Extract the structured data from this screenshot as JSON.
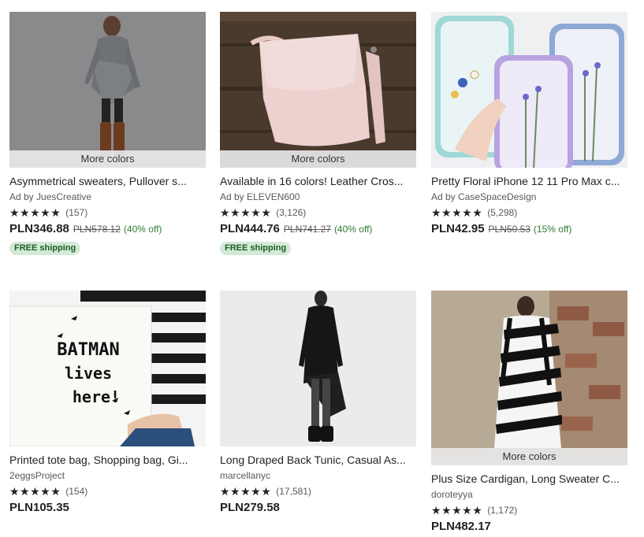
{
  "listings": [
    {
      "more_colors": "More colors",
      "title": "Asymmetrical sweaters, Pullover s...",
      "seller": "Ad by JuesCreative",
      "stars": "★★★★★",
      "reviews": "(157)",
      "price": "PLN346.88",
      "original_price": "PLN578.12",
      "discount": "(40% off)",
      "shipping": "FREE shipping"
    },
    {
      "more_colors": "More colors",
      "title": "Available in 16 colors! Leather Cros...",
      "seller": "Ad by ELEVEN600",
      "stars": "★★★★★",
      "reviews": "(3,126)",
      "price": "PLN444.76",
      "original_price": "PLN741.27",
      "discount": "(40% off)",
      "shipping": "FREE shipping"
    },
    {
      "title": "Pretty Floral iPhone 12 11 Pro Max c...",
      "seller": "Ad by CaseSpaceDesign",
      "stars": "★★★★★",
      "reviews": "(5,298)",
      "price": "PLN42.95",
      "original_price": "PLN50.53",
      "discount": "(15% off)"
    },
    {
      "title": "Printed tote bag, Shopping bag, Gi...",
      "seller": "2eggsProject",
      "stars": "★★★★★",
      "reviews": "(154)",
      "price": "PLN105.35",
      "image_text": [
        "BATMAN",
        "lives",
        "here!"
      ]
    },
    {
      "title": "Long Draped Back Tunic, Casual As...",
      "seller": "marcellanyc",
      "stars": "★★★★★",
      "reviews": "(17,581)",
      "price": "PLN279.58"
    },
    {
      "more_colors": "More colors",
      "title": "Plus Size Cardigan, Long Sweater C...",
      "seller": "doroteyya",
      "stars": "★★★★★",
      "reviews": "(1,172)",
      "price": "PLN482.17"
    }
  ],
  "colors": {
    "discount_green": "#2e7d32",
    "shipping_badge_bg": "#d4e9d7",
    "text": "#222222"
  }
}
